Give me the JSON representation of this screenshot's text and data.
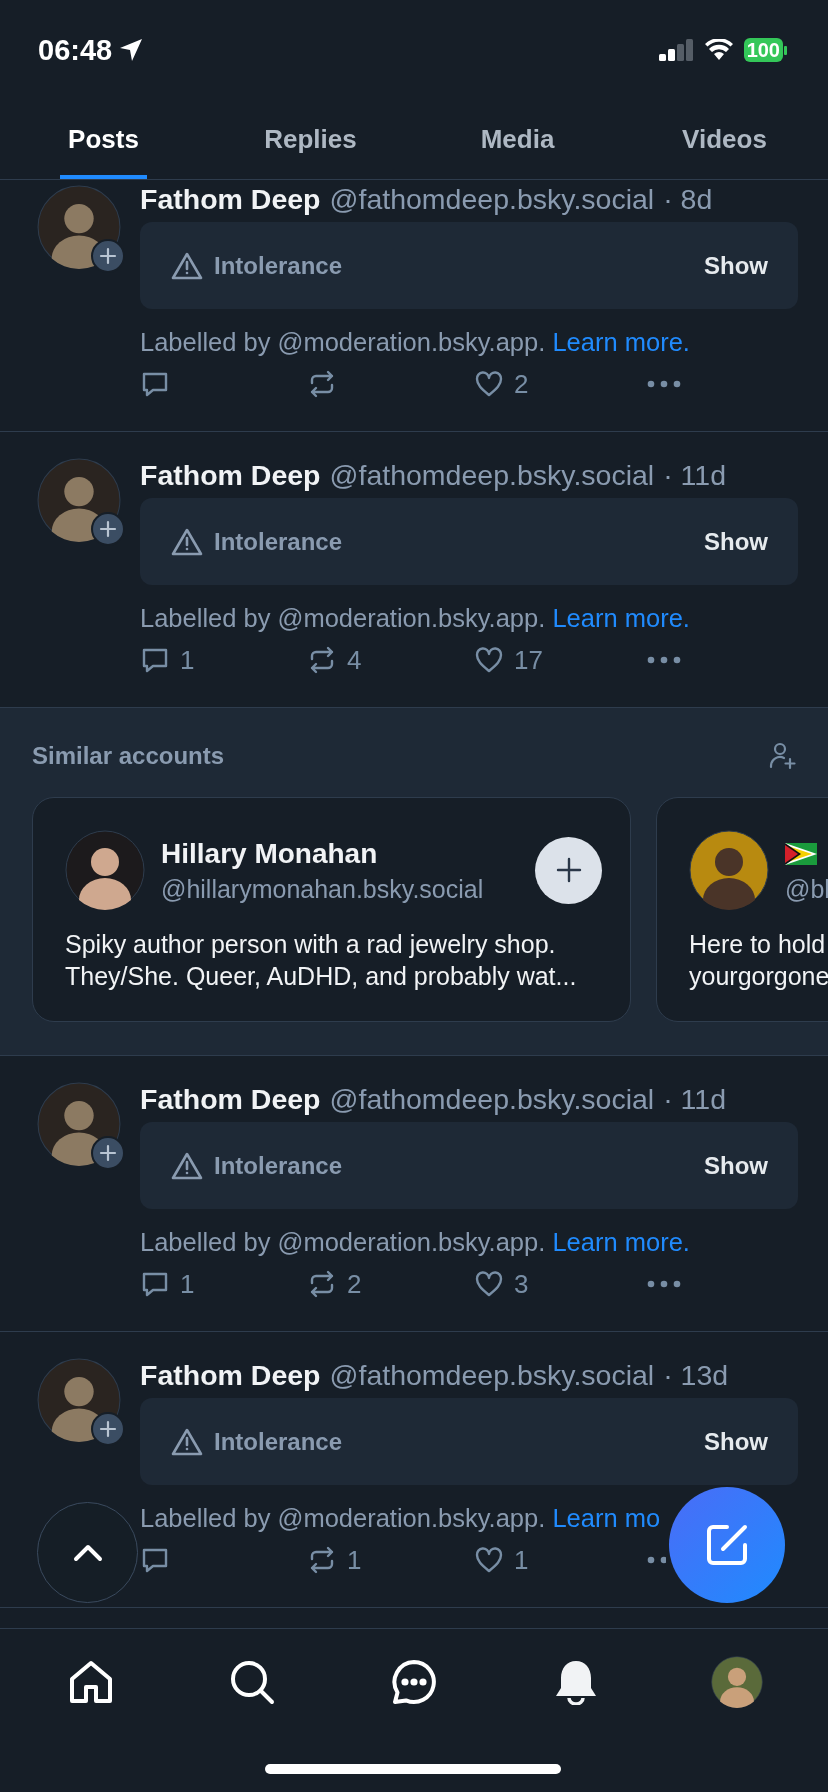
{
  "status_bar": {
    "time": "06:48",
    "battery": "100"
  },
  "tabs": [
    {
      "label": "Posts",
      "selected": true
    },
    {
      "label": "Replies",
      "selected": false
    },
    {
      "label": "Media",
      "selected": false
    },
    {
      "label": "Videos",
      "selected": false
    }
  ],
  "feed": [
    {
      "kind": "post",
      "author": "Fathom Deep",
      "handle": "@fathomdeep.bsky.social",
      "age": "· 8d",
      "warning": "Intolerance",
      "warning_action": "Show",
      "labelled_by": "Labelled by @moderation.bsky.app.",
      "learn_more": "Learn more.",
      "likes": "2"
    },
    {
      "kind": "post",
      "author": "Fathom Deep",
      "handle": "@fathomdeep.bsky.social",
      "age": "· 11d",
      "warning": "Intolerance",
      "warning_action": "Show",
      "labelled_by": "Labelled by @moderation.bsky.app.",
      "learn_more": "Learn more.",
      "replies": "1",
      "reposts": "4",
      "likes": "17"
    },
    {
      "kind": "similar",
      "title": "Similar accounts",
      "accounts": [
        {
          "name": "Hillary Monahan",
          "handle": "@hillarymonahan.bsky.social",
          "bio": [
            "Spiky author person with a rad jewelry shop.",
            "They/She. Queer, AuDHD, and probably wat..."
          ],
          "follow_button": true
        },
        {
          "handle": "@bl",
          "bio": [
            "Here to hold",
            "yourgorgone"
          ]
        }
      ]
    },
    {
      "kind": "post",
      "author": "Fathom Deep",
      "handle": "@fathomdeep.bsky.social",
      "age": "· 11d",
      "warning": "Intolerance",
      "warning_action": "Show",
      "labelled_by": "Labelled by @moderation.bsky.app.",
      "learn_more": "Learn more.",
      "replies": "1",
      "reposts": "2",
      "likes": "3"
    },
    {
      "kind": "post",
      "author": "Fathom Deep",
      "handle": "@fathomdeep.bsky.social",
      "age": "· 13d",
      "warning": "Intolerance",
      "warning_action": "Show",
      "labelled_by": "Labelled by @moderation.bsky.app.",
      "learn_more": "Learn mo",
      "reposts": "1",
      "likes": "1"
    }
  ],
  "nav": [
    {
      "kind": "home"
    },
    {
      "kind": "search"
    },
    {
      "kind": "chat"
    },
    {
      "kind": "notifications"
    },
    {
      "kind": "profile"
    }
  ]
}
